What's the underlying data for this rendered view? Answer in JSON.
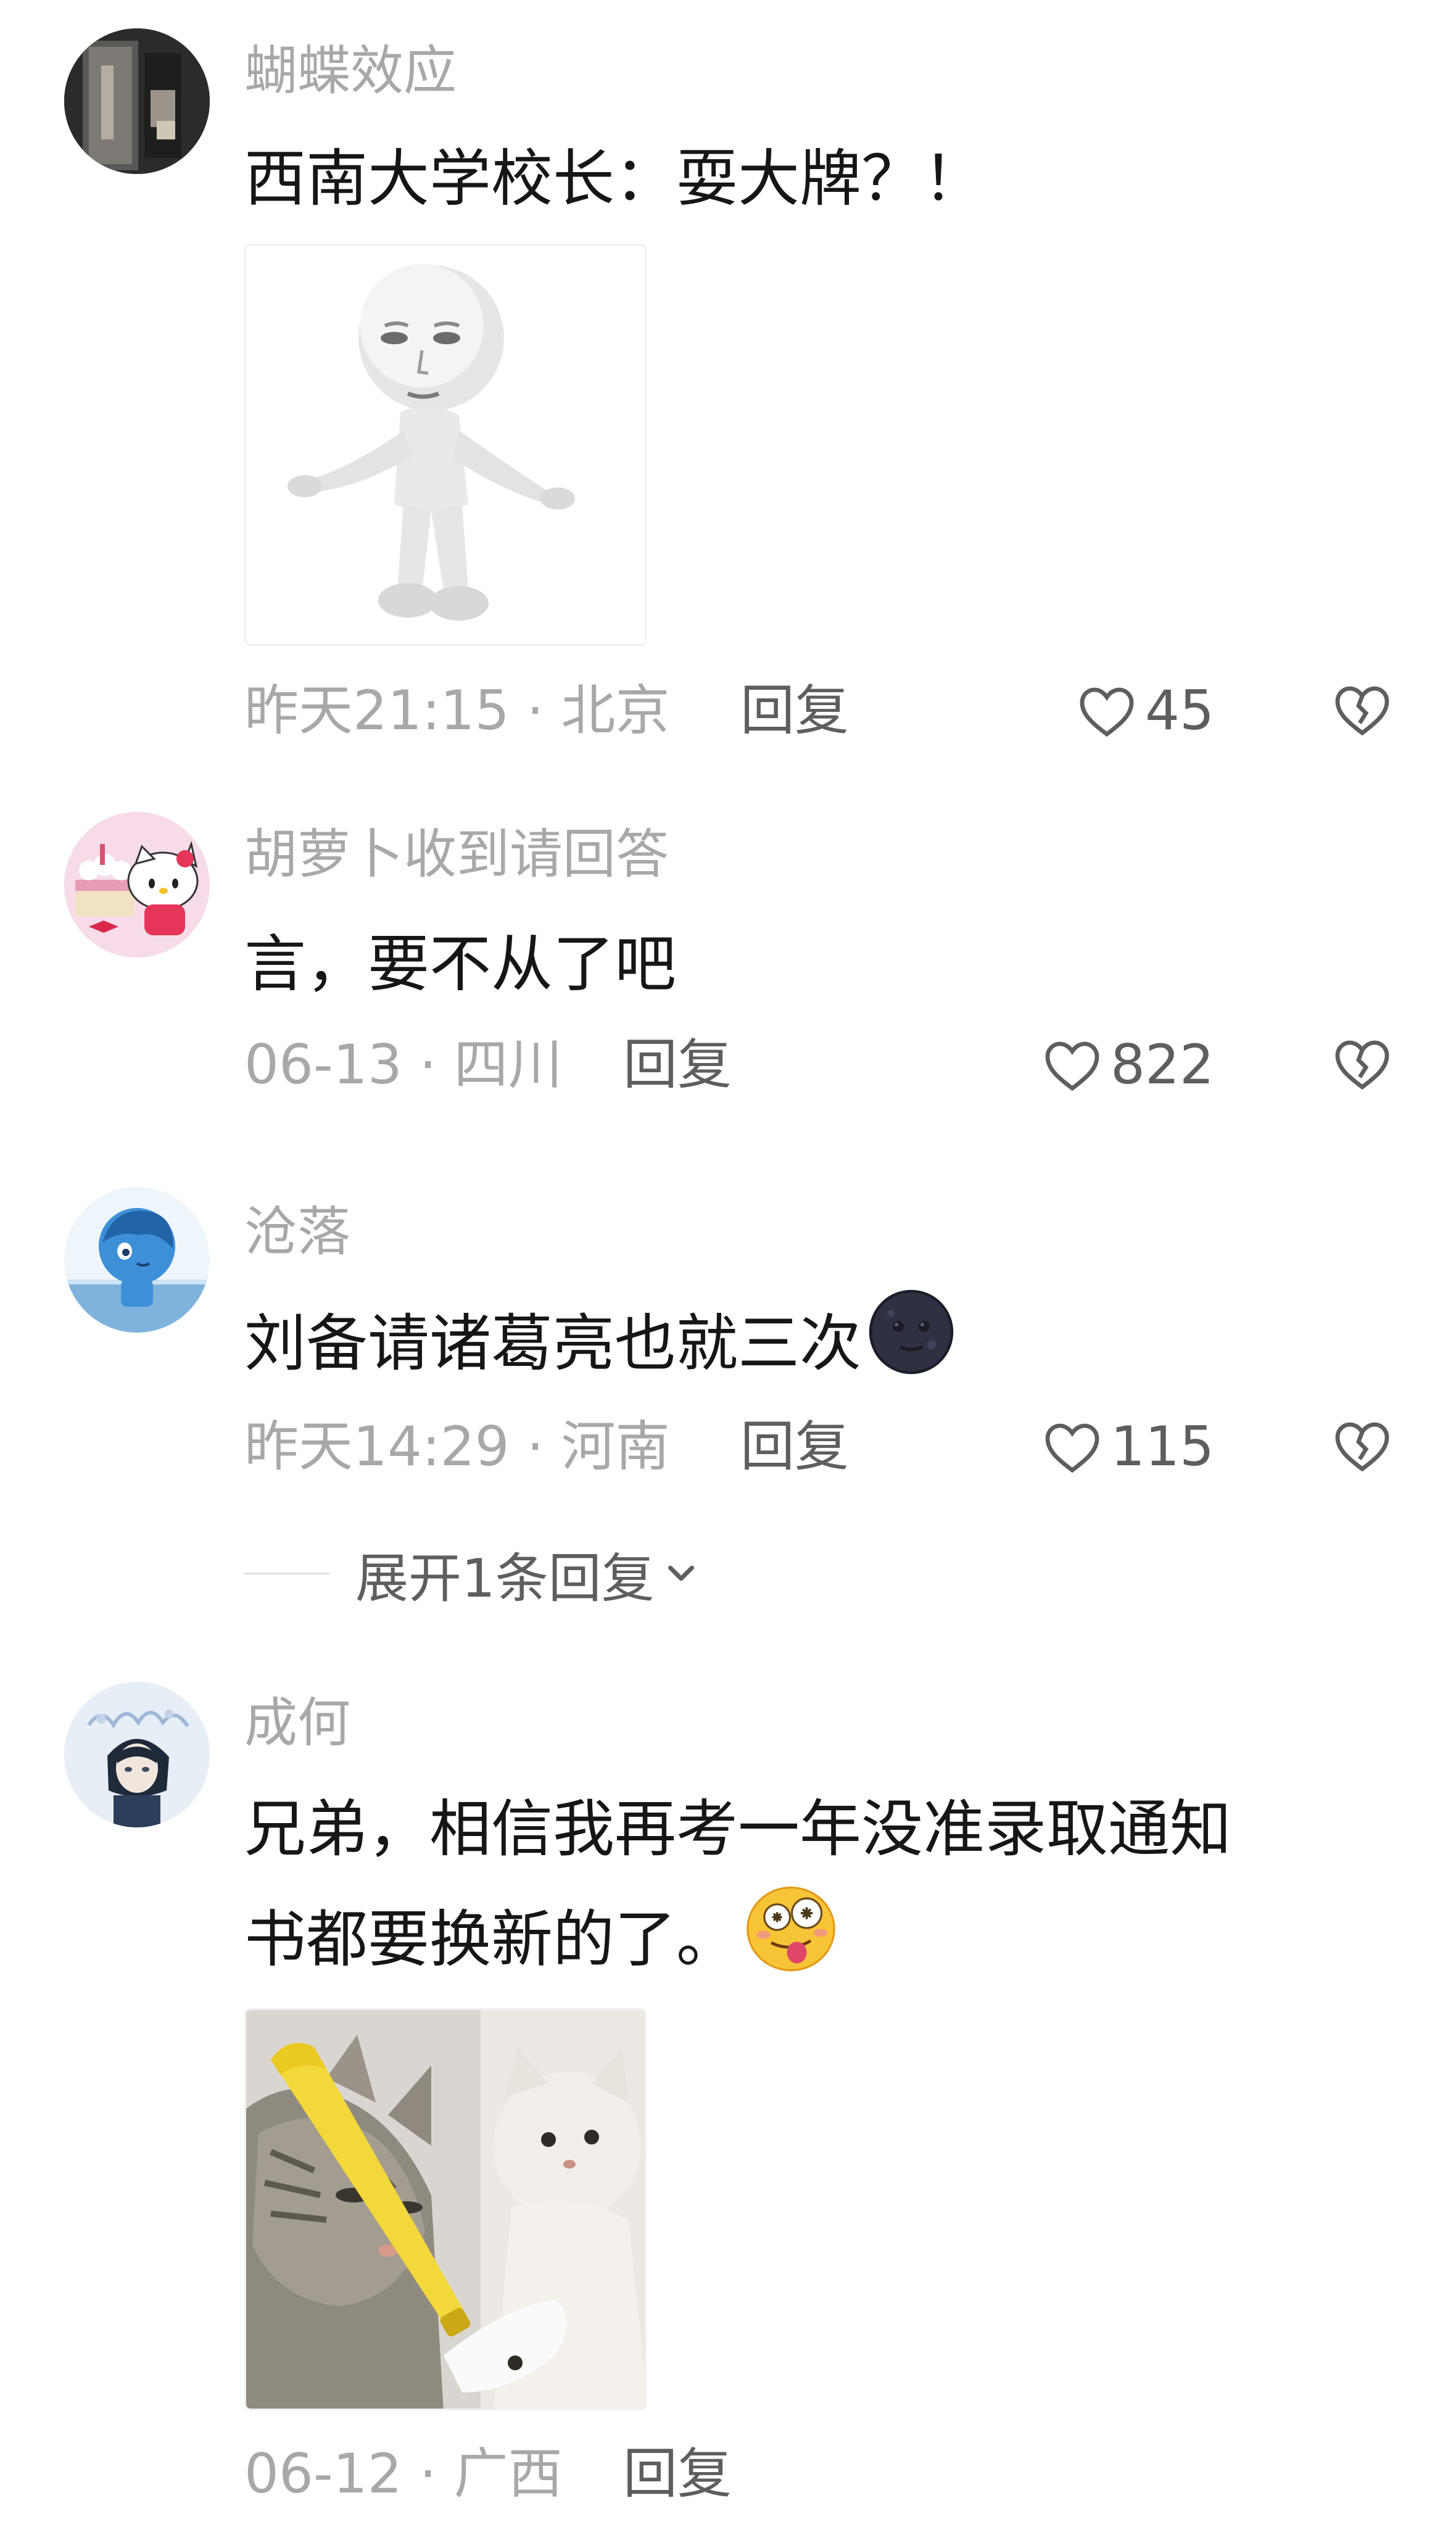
{
  "comments": [
    {
      "username": "蝴蝶效应",
      "content_lines": [
        "西南大学校长：耍大牌？！"
      ],
      "sticker": "3d-white-figure-shrugging",
      "time_location": "昨天21:15 · 北京",
      "reply_label": "回复",
      "likes": "45"
    },
    {
      "username": "胡萝卜收到请回答",
      "content_lines": [
        "言，要不从了吧"
      ],
      "time_location": "06-13 · 四川",
      "reply_label": "回复",
      "likes": "822"
    },
    {
      "username": "沧落",
      "content_lines": [
        "刘备请诸葛亮也就三次"
      ],
      "emoji": "dark-moon-face-emoji",
      "time_location": "昨天14:29 · 河南",
      "reply_label": "回复",
      "likes": "115",
      "expand_label": "展开1条回复"
    },
    {
      "username": "成何",
      "content_lines": [
        "兄弟，相信我再考一年没准录取通知",
        "书都要换新的了。"
      ],
      "emoji": "dizzy-tongue-face-emoji",
      "sticker": "cat-hitting-cat-with-yellow-bat",
      "time_location": "06-12 · 广西",
      "reply_label": "回复"
    }
  ],
  "colors": {
    "username": "#a8a8a8",
    "content": "#161616",
    "meta": "#a8a8a8",
    "reply": "#5e5e5e"
  }
}
